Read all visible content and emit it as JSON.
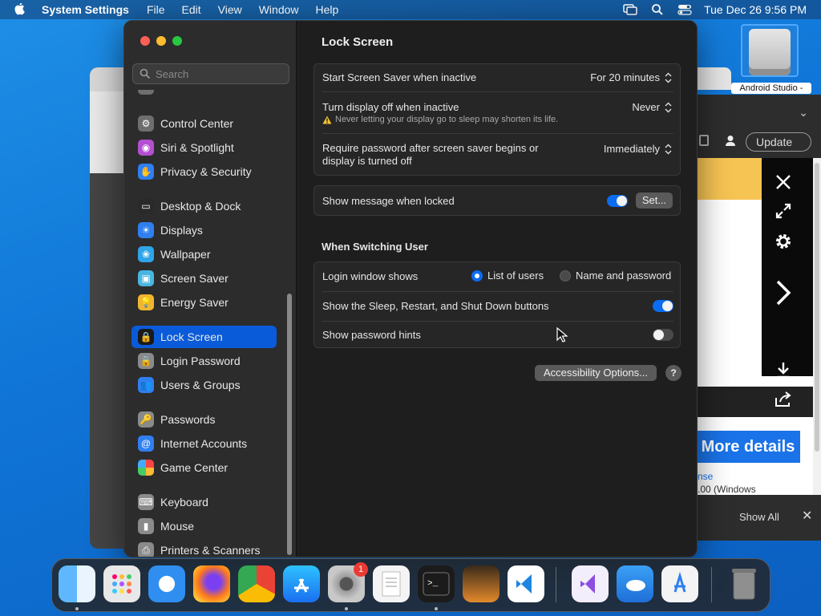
{
  "menubar": {
    "app_name": "System Settings",
    "items": [
      "File",
      "Edit",
      "View",
      "Window",
      "Help"
    ],
    "clock": "Tue Dec 26  9:56 PM"
  },
  "desktop": {
    "file_label": "Android Studio -"
  },
  "browser_panel": {
    "update_label": "Update",
    "more_details": "More details",
    "link_text": "nse",
    "windows_text": ".00 (Windows",
    "show_all": "Show All"
  },
  "window": {
    "search": {
      "placeholder": "Search"
    },
    "sidebar": {
      "items": [
        {
          "label": "Control Center",
          "icon": "control-center-icon",
          "color": "#6e6e6e"
        },
        {
          "label": "Siri & Spotlight",
          "icon": "siri-icon",
          "color": "#b44fd1"
        },
        {
          "label": "Privacy & Security",
          "icon": "hand-icon",
          "color": "#2f7ff0"
        },
        {
          "label": "Desktop & Dock",
          "icon": "dock-icon",
          "color": "#2a2a2a"
        },
        {
          "label": "Displays",
          "icon": "sun-icon",
          "color": "#2f7ff0"
        },
        {
          "label": "Wallpaper",
          "icon": "flower-icon",
          "color": "#2fa4e8"
        },
        {
          "label": "Screen Saver",
          "icon": "screen-saver-icon",
          "color": "#4ab6e0"
        },
        {
          "label": "Energy Saver",
          "icon": "battery-icon",
          "color": "#f0b62f"
        },
        {
          "label": "Lock Screen",
          "icon": "lock-icon",
          "color": "#1a1a1a"
        },
        {
          "label": "Login Password",
          "icon": "lock-icon",
          "color": "#8a8a8a"
        },
        {
          "label": "Users & Groups",
          "icon": "users-icon",
          "color": "#2f7ff0"
        },
        {
          "label": "Passwords",
          "icon": "key-icon",
          "color": "#8a8a8a"
        },
        {
          "label": "Internet Accounts",
          "icon": "at-icon",
          "color": "#2f7ff0"
        },
        {
          "label": "Game Center",
          "icon": "game-center-icon",
          "color": "#e8e8e8"
        },
        {
          "label": "Keyboard",
          "icon": "keyboard-icon",
          "color": "#8a8a8a"
        },
        {
          "label": "Mouse",
          "icon": "mouse-icon",
          "color": "#8a8a8a"
        },
        {
          "label": "Printers & Scanners",
          "icon": "printer-icon",
          "color": "#8a8a8a"
        }
      ],
      "selected": "Lock Screen"
    },
    "content": {
      "title": "Lock Screen",
      "screen_saver": {
        "label": "Start Screen Saver when inactive",
        "value": "For 20 minutes"
      },
      "display_off": {
        "label": "Turn display off when inactive",
        "value": "Never",
        "warning": "Never letting your display go to sleep may shorten its life."
      },
      "require_password": {
        "label_line1": "Require password after screen saver begins or",
        "label_line2": "display is turned off",
        "value": "Immediately"
      },
      "show_message": {
        "label": "Show message when locked",
        "on": true,
        "button": "Set..."
      },
      "switching_title": "When Switching User",
      "login_window": {
        "label": "Login window shows",
        "option1": "List of users",
        "option2": "Name and password",
        "selected": "List of users"
      },
      "sleep_buttons": {
        "label": "Show the Sleep, Restart, and Shut Down buttons",
        "on": true
      },
      "password_hints": {
        "label": "Show password hints",
        "on": false
      },
      "accessibility_button": "Accessibility Options...",
      "help_button": "?"
    }
  },
  "dock": {
    "apps": [
      "finder-icon",
      "launchpad-icon",
      "safari-icon",
      "firefox-icon",
      "chrome-icon",
      "app-store-icon",
      "system-settings-icon",
      "textedit-icon",
      "terminal-icon",
      "garageband-icon",
      "vscode-icon",
      "visual-studio-icon",
      "weather-icon",
      "xcode-instruments-icon",
      "trash-icon"
    ],
    "settings_badge": "1"
  },
  "colors": {
    "accent": "#0a6cf2",
    "selected": "#0a5bd9",
    "warning": "#f2c230"
  }
}
